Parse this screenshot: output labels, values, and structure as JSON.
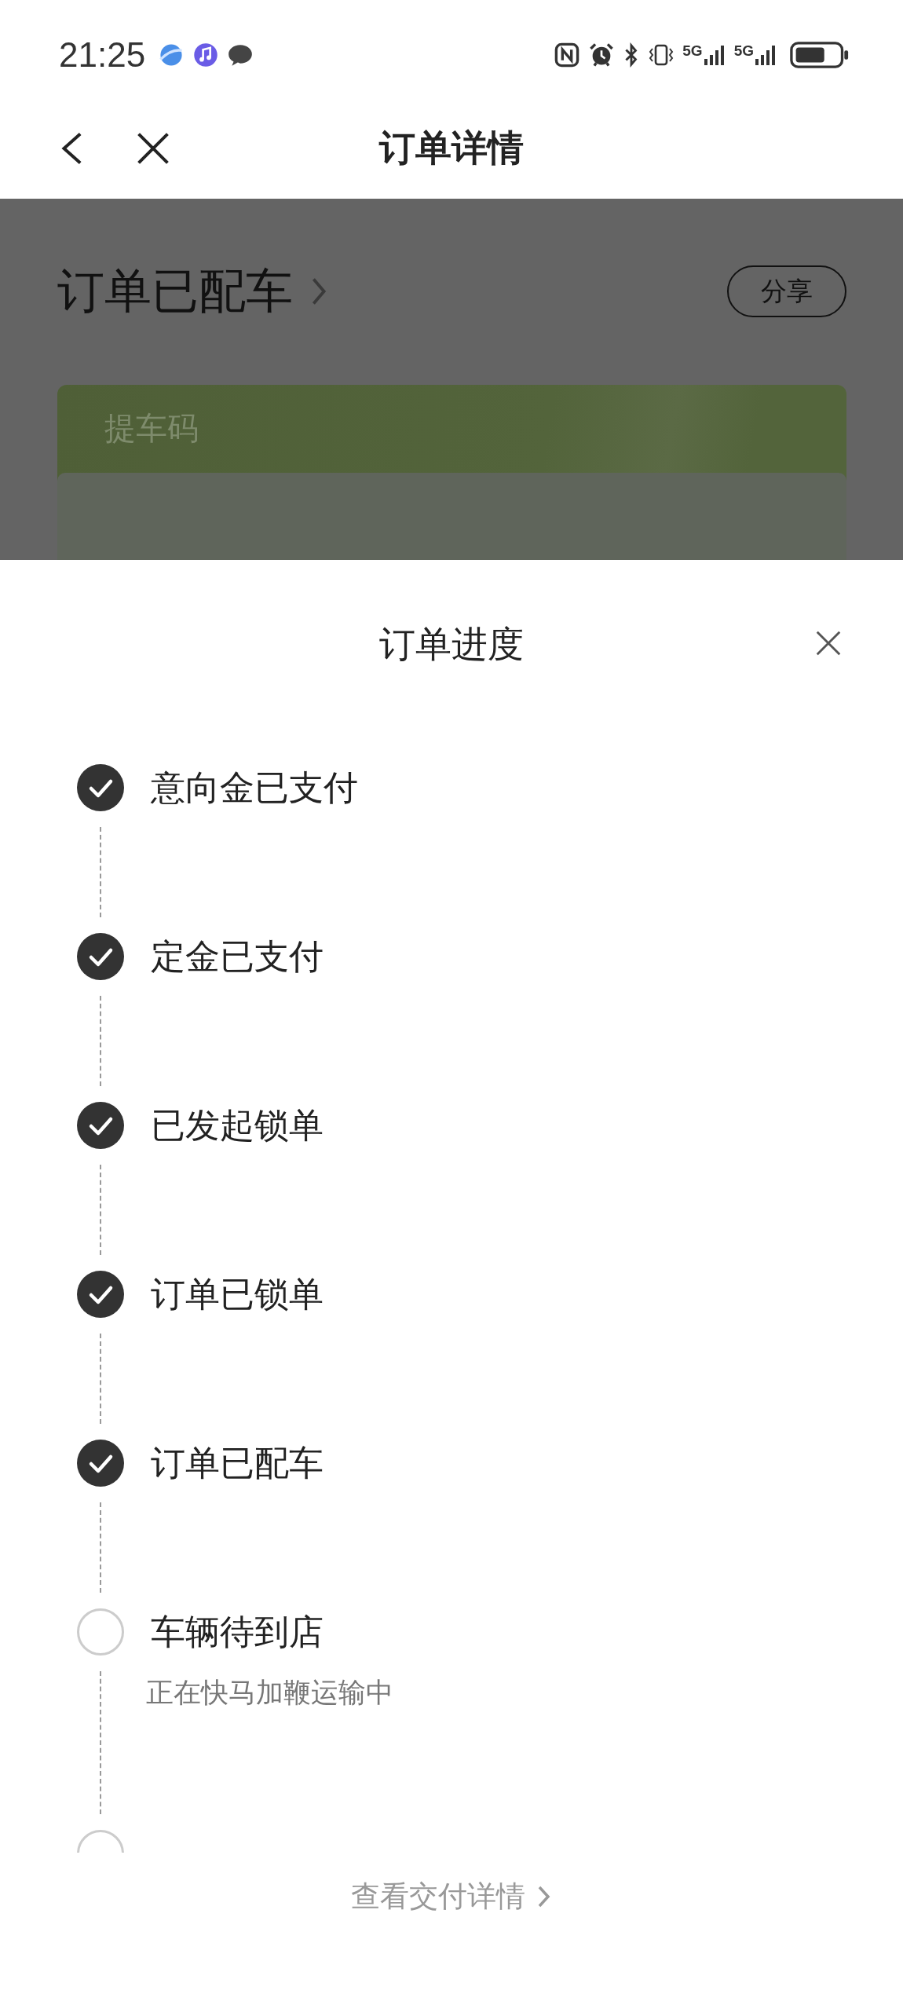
{
  "status_bar": {
    "time": "21:25",
    "network_labels": [
      "5G",
      "5G"
    ]
  },
  "nav": {
    "title": "订单详情"
  },
  "order": {
    "status": "订单已配车",
    "share": "分享",
    "card_label": "提车码"
  },
  "sheet": {
    "title": "订单进度",
    "steps": [
      {
        "label": "意向金已支付",
        "done": true
      },
      {
        "label": "定金已支付",
        "done": true
      },
      {
        "label": "已发起锁单",
        "done": true
      },
      {
        "label": "订单已锁单",
        "done": true
      },
      {
        "label": "订单已配车",
        "done": true
      },
      {
        "label": "车辆待到店",
        "done": false,
        "note": "正在快马加鞭运输中"
      },
      {
        "done": false
      }
    ],
    "footer_link": "查看交付详情"
  }
}
